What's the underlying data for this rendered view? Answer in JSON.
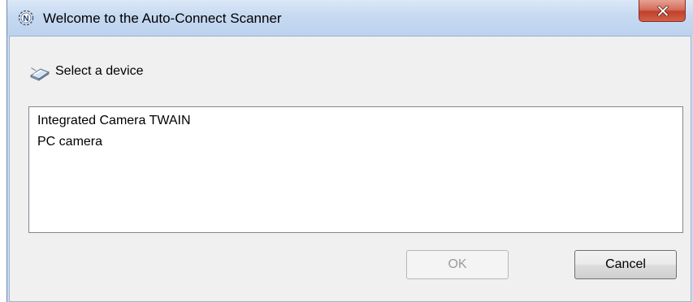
{
  "window": {
    "title": "Welcome to the Auto-Connect Scanner",
    "app_icon_letter": "N",
    "app_icon": "gear-n-icon",
    "close_icon": "close-icon"
  },
  "prompt": {
    "icon": "scanner-icon",
    "text": "Select a device"
  },
  "device_list": {
    "items": [
      {
        "label": "Integrated Camera TWAIN"
      },
      {
        "label": "PC camera"
      }
    ]
  },
  "buttons": {
    "ok_label": "OK",
    "ok_enabled": false,
    "cancel_label": "Cancel"
  },
  "colors": {
    "titlebar": "#c6d9f1",
    "close_button": "#c1412b",
    "dialog_background": "#f0f0f0",
    "disabled_text": "#9a9a9a"
  }
}
